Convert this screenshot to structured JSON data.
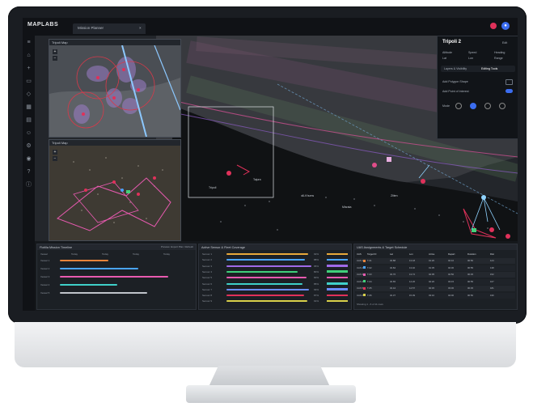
{
  "app": {
    "logo": "MAPLABS",
    "tab_title": "Mission Planner",
    "tab_close": "×",
    "accent": "#3b6df0",
    "alert_color": "#e0315a"
  },
  "icons": {
    "sidebar": [
      "menu-icon",
      "home-icon",
      "plus-icon",
      "folder-icon",
      "layers-icon",
      "grid-icon",
      "document-icon",
      "person-icon",
      "settings-icon",
      "eye-icon",
      "help-icon",
      "info-icon"
    ]
  },
  "map": {
    "panel_top_title": "Tripoli Map",
    "panel_bottom_title": "Tripoli Map",
    "place_labels": [
      "Tripoli",
      "Al-Khums",
      "Tajura",
      "Misrata",
      "Zliten"
    ]
  },
  "detail": {
    "title": "Tripoli 2",
    "right_label": "Edit",
    "stats": [
      "Altitude",
      "Speed",
      "Heading",
      "Lat",
      "Lon",
      "Range"
    ],
    "tabs": [
      "Layers & Visibility",
      "Editing Tools"
    ],
    "rows": [
      "Add Polygon Shape",
      "Add Point of Interest"
    ],
    "mode_label": "Mode"
  },
  "bottom": {
    "timeline_title": "Flotilla Mission Timeline",
    "timeline_actions": [
      "Preview",
      "Export Plan",
      "Refresh"
    ],
    "timeline_cols": [
      "Vessel",
      "Today",
      "Today",
      "Today",
      "Today"
    ],
    "timeline_rows": [
      "Vessel 1",
      "Vessel 2",
      "Vessel 3",
      "Vessel 4",
      "Vessel 5"
    ],
    "coverage_title": "Active Sensor & Fleet Coverage",
    "coverage_rows": [
      "Sensor 1",
      "Sensor 2",
      "Sensor 3",
      "Sensor 4",
      "Sensor 5",
      "Sensor 6",
      "Sensor 7",
      "Sensor 8",
      "Sensor 9"
    ],
    "coverage_values": [
      92,
      88,
      95,
      80,
      90,
      85,
      93,
      87,
      91
    ],
    "assignments_title": "UAS Assignments & Target Schedule",
    "assignments_cols": [
      "UAS",
      "Target ID",
      "Lat",
      "Lon",
      "Arrive",
      "Depart",
      "Duration",
      "Dist"
    ],
    "assignments_rows": [
      [
        "UAS 1",
        "T-01",
        "32.88",
        "13.18",
        "01:20",
        "02:10",
        "00:50",
        "124"
      ],
      [
        "UAS 2",
        "T-02",
        "32.84",
        "13.40",
        "01:35",
        "02:30",
        "00:55",
        "138"
      ],
      [
        "UAS 3",
        "T-03",
        "32.76",
        "13.72",
        "02:05",
        "02:50",
        "00:45",
        "152"
      ],
      [
        "UAS 4",
        "T-04",
        "32.65",
        "14.26",
        "02:20",
        "03:15",
        "00:55",
        "167"
      ],
      [
        "UAS 5",
        "T-05",
        "32.44",
        "14.57",
        "02:45",
        "03:30",
        "00:45",
        "181"
      ],
      [
        "UAS 6",
        "T-06",
        "32.37",
        "15.09",
        "03:10",
        "04:00",
        "00:50",
        "196"
      ]
    ],
    "assignments_footer": "Showing 1 - 6 of 11 rows"
  }
}
